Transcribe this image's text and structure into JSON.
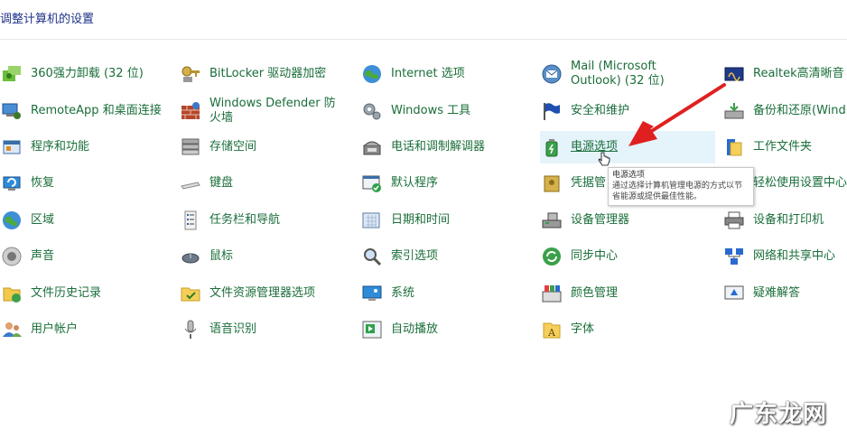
{
  "header": {
    "title": "调整计算机的设置"
  },
  "columns": [
    [
      {
        "label": "360强力卸载 (32 位)",
        "icon": "uninstall-icon"
      },
      {
        "label": "RemoteApp 和桌面连接",
        "icon": "remote-desktop-icon"
      },
      {
        "label": "程序和功能",
        "icon": "programs-icon"
      },
      {
        "label": "恢复",
        "icon": "recovery-icon"
      },
      {
        "label": "区域",
        "icon": "region-globe-icon"
      },
      {
        "label": "声音",
        "icon": "speaker-icon"
      },
      {
        "label": "文件历史记录",
        "icon": "file-history-icon"
      },
      {
        "label": "用户帐户",
        "icon": "user-accounts-icon"
      }
    ],
    [
      {
        "label": "BitLocker 驱动器加密",
        "icon": "bitlocker-key-icon"
      },
      {
        "label": "Windows Defender 防火墙",
        "icon": "firewall-icon"
      },
      {
        "label": "存储空间",
        "icon": "storage-spaces-icon"
      },
      {
        "label": "键盘",
        "icon": "keyboard-icon"
      },
      {
        "label": "任务栏和导航",
        "icon": "taskbar-icon"
      },
      {
        "label": "鼠标",
        "icon": "mouse-icon"
      },
      {
        "label": "文件资源管理器选项",
        "icon": "folder-options-icon"
      },
      {
        "label": "语音识别",
        "icon": "microphone-icon"
      }
    ],
    [
      {
        "label": "Internet 选项",
        "icon": "internet-globe-icon"
      },
      {
        "label": "Windows 工具",
        "icon": "gear-tools-icon"
      },
      {
        "label": "电话和调制解调器",
        "icon": "phone-modem-icon"
      },
      {
        "label": "默认程序",
        "icon": "default-programs-icon"
      },
      {
        "label": "日期和时间",
        "icon": "calendar-clock-icon"
      },
      {
        "label": "索引选项",
        "icon": "index-magnifier-icon"
      },
      {
        "label": "系统",
        "icon": "system-monitor-icon"
      },
      {
        "label": "自动播放",
        "icon": "autoplay-icon"
      }
    ],
    [
      {
        "label": "Mail (Microsoft Outlook) (32 位)",
        "icon": "mail-icon"
      },
      {
        "label": "安全和维护",
        "icon": "security-flag-icon"
      },
      {
        "label": "电源选项",
        "icon": "power-options-icon"
      },
      {
        "label": "凭据管",
        "icon": "credential-vault-icon"
      },
      {
        "label": "设备管理器",
        "icon": "device-manager-icon"
      },
      {
        "label": "同步中心",
        "icon": "sync-icon"
      },
      {
        "label": "颜色管理",
        "icon": "color-management-icon"
      },
      {
        "label": "字体",
        "icon": "fonts-icon"
      }
    ],
    [
      {
        "label": "Realtek高清晰音",
        "icon": "realtek-audio-icon"
      },
      {
        "label": "备份和还原(Wind",
        "icon": "backup-restore-icon"
      },
      {
        "label": "工作文件夹",
        "icon": "work-folders-icon"
      },
      {
        "label": "轻松使用设置中心",
        "icon": "ease-of-access-icon"
      },
      {
        "label": "设备和打印机",
        "icon": "printer-icon"
      },
      {
        "label": "网络和共享中心",
        "icon": "network-icon"
      },
      {
        "label": "疑难解答",
        "icon": "troubleshoot-icon"
      }
    ]
  ],
  "tooltip": {
    "title": "电源选项",
    "text": "通过选择计算机管理电源的方式以节省能源或提供最佳性能。"
  },
  "watermark": "广东龙网",
  "colors": {
    "link": "#1a6e3a",
    "header": "#1e3287",
    "hover": "#e5f3fb",
    "arrow": "#e02020"
  }
}
